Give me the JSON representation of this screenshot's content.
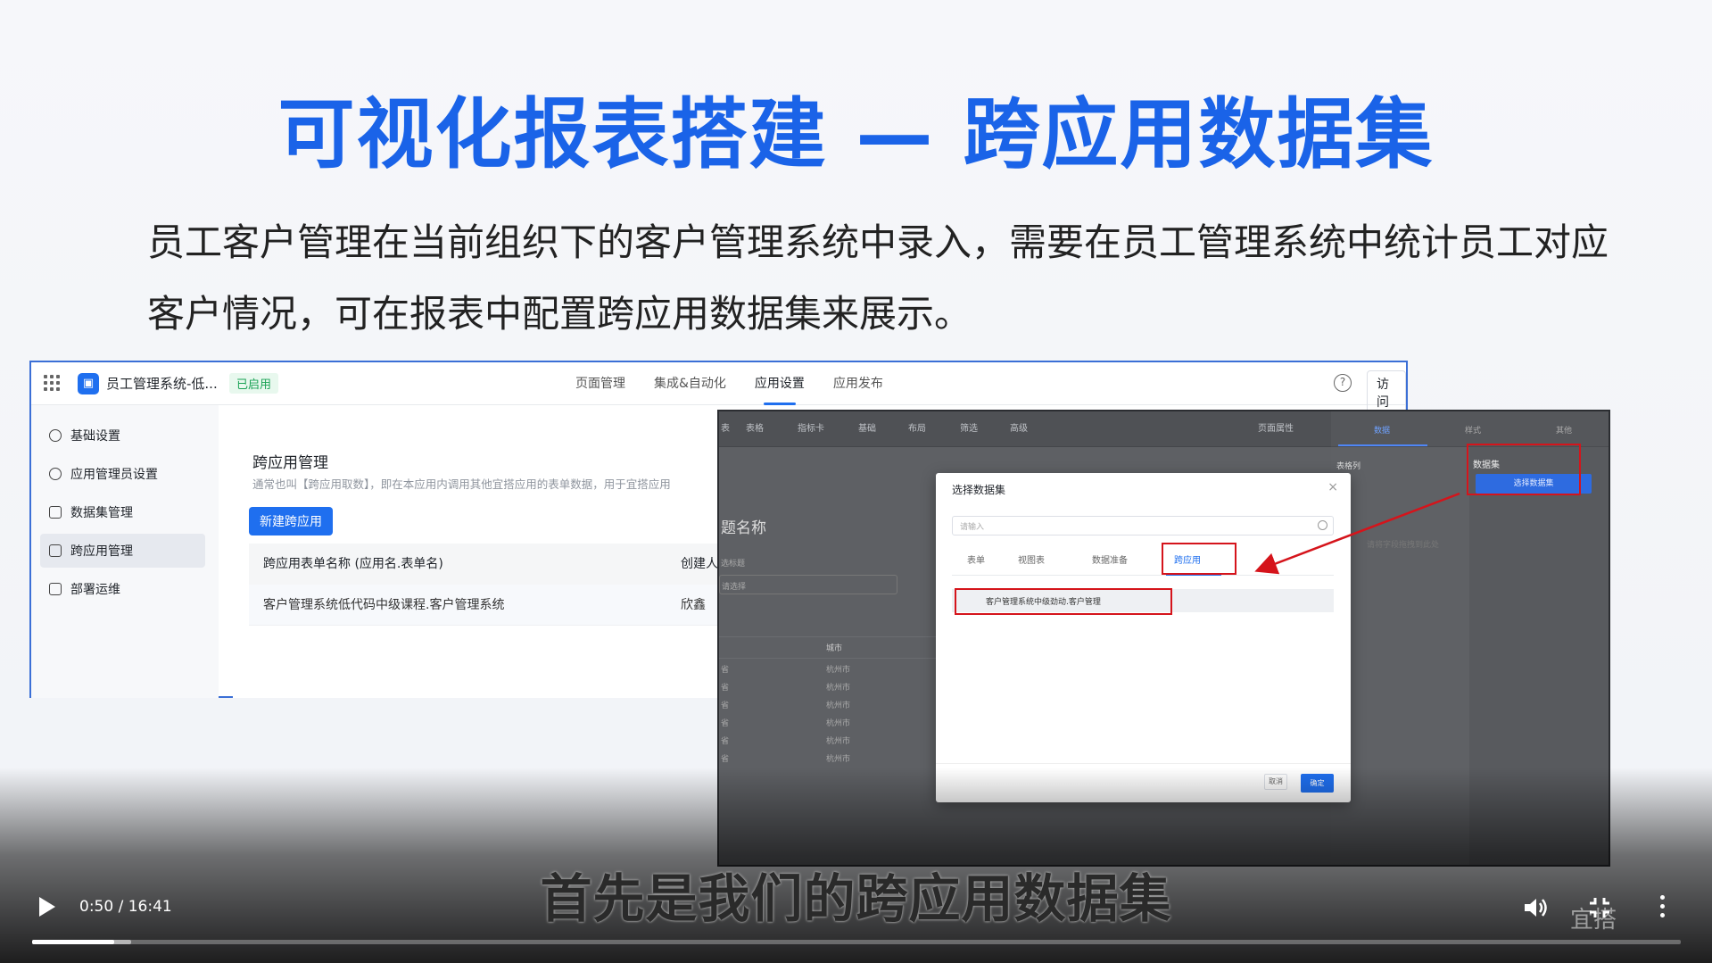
{
  "slide": {
    "title": "可视化报表搭建 — 跨应用数据集",
    "description": "员工客户管理在当前组织下的客户管理系统中录入，需要在员工管理系统中统计员工对应客户情况，可在报表中配置跨应用数据集来展示。"
  },
  "app": {
    "name": "员工管理系统-低...",
    "status": "已启用",
    "nav_tabs": [
      "页面管理",
      "集成&自动化",
      "应用设置",
      "应用发布"
    ],
    "active_tab": "应用设置",
    "help_icon": "?",
    "visit_label": "访问",
    "sidebar": [
      "基础设置",
      "应用管理员设置",
      "数据集管理",
      "跨应用管理",
      "部署运维"
    ],
    "sidebar_active": "跨应用管理",
    "content": {
      "title": "跨应用管理",
      "desc": "通常也叫【跨应用取数】，即在本应用内调用其他宜搭应用的表单数据，用于宜搭应用",
      "new_button": "新建跨应用",
      "table_headers": [
        "跨应用表单名称 (应用名.表单名)",
        "创建人"
      ],
      "table_rows": [
        [
          "客户管理系统低代码中级课程.客户管理系统",
          "欣鑫"
        ]
      ]
    }
  },
  "editor": {
    "toolbar": [
      "表",
      "表格",
      "指标卡",
      "基础",
      "布局",
      "筛选",
      "高级",
      "页面属性"
    ],
    "card_title": "题名称",
    "filter_label": "选标题",
    "select_placeholder": "请选择",
    "columns": [
      "城市"
    ],
    "rows": [
      [
        "省",
        "杭州市"
      ],
      [
        "省",
        "杭州市"
      ],
      [
        "省",
        "杭州市"
      ],
      [
        "省",
        "杭州市"
      ],
      [
        "省",
        "杭州市"
      ],
      [
        "省",
        "杭州市"
      ]
    ],
    "right_tabs": [
      "数据",
      "样式",
      "其他"
    ],
    "panel_label": "表格列",
    "panel_hint": "请将字段拖拽到此处",
    "dataset_label": "数据集",
    "dataset_button": "选择数据集"
  },
  "modal": {
    "title": "选择数据集",
    "close": "×",
    "search_placeholder": "请输入",
    "tabs": [
      "表单",
      "视图表",
      "数据准备",
      "跨应用"
    ],
    "active_tab": "跨应用",
    "row": "客户管理系统中级劲动.客户管理",
    "cancel": "取消",
    "ok": "确定"
  },
  "player": {
    "subtitle": "首先是我们的跨应用数据集",
    "time": "0:50 / 16:41",
    "progress_fraction": 0.05,
    "buffered_fraction": 0.06,
    "watermark": "宜搭"
  },
  "colors": {
    "accent": "#1a63e8",
    "primary_button": "#1f6fef",
    "highlight_red": "#d5141b"
  }
}
